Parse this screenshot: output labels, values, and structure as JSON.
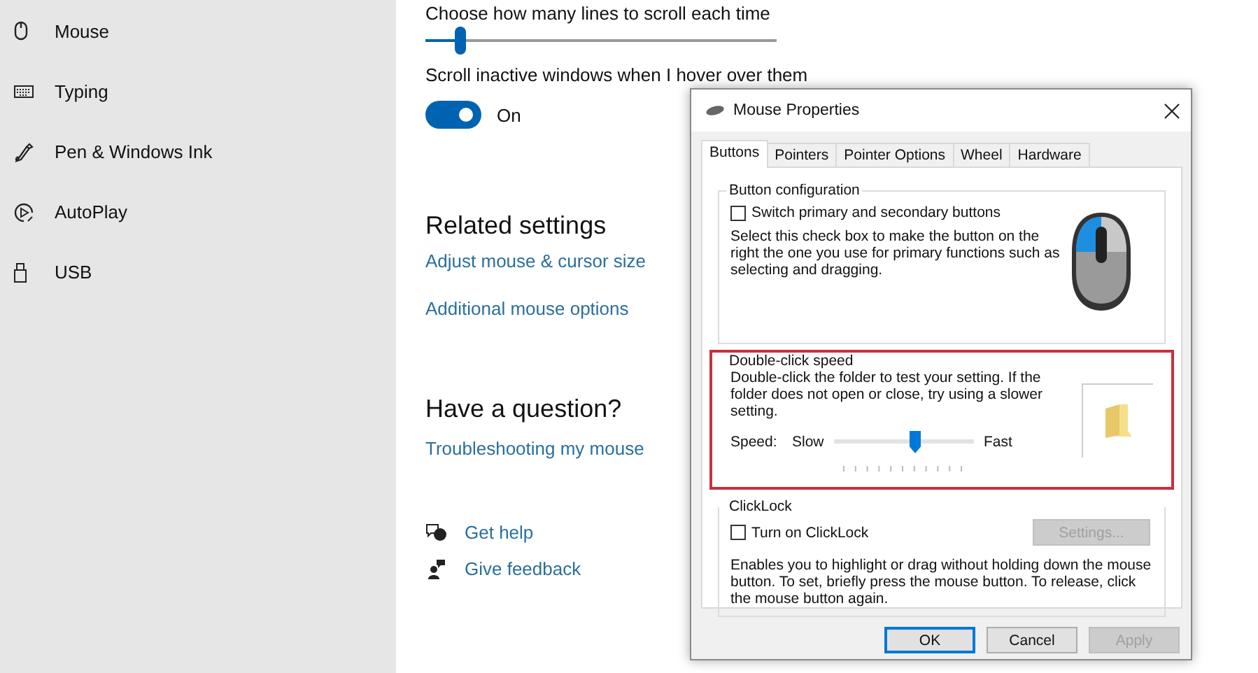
{
  "sidebar": {
    "items": [
      {
        "kind": "mouse",
        "label": "Mouse"
      },
      {
        "kind": "keyboard",
        "label": "Typing"
      },
      {
        "kind": "pen",
        "label": "Pen & Windows Ink"
      },
      {
        "kind": "autoplay",
        "label": "AutoPlay"
      },
      {
        "kind": "usb",
        "label": "USB"
      }
    ]
  },
  "main": {
    "wheel_lines": {
      "label": "Choose how many lines to scroll each time",
      "level": 0.1
    },
    "inactive_scroll": {
      "label": "Scroll inactive windows when I hover over them",
      "on": true,
      "state_text": "On"
    },
    "related": {
      "title": "Related settings",
      "links": [
        "Adjust mouse & cursor size",
        "Additional mouse options"
      ]
    },
    "question": {
      "title": "Have a question?",
      "links": [
        "Troubleshooting my mouse"
      ]
    },
    "help_links": [
      {
        "kind": "help",
        "label": "Get help"
      },
      {
        "kind": "feedback",
        "label": "Give feedback"
      }
    ]
  },
  "dialog": {
    "title": "Mouse Properties",
    "tabs": [
      {
        "label": "Buttons",
        "selected": true
      },
      {
        "label": "Pointers",
        "selected": false
      },
      {
        "label": "Pointer Options",
        "selected": false
      },
      {
        "label": "Wheel",
        "selected": false
      },
      {
        "label": "Hardware",
        "selected": false
      }
    ],
    "button_configuration": {
      "legend": "Button configuration",
      "checkbox": {
        "label": "Switch primary and secondary buttons",
        "checked": false
      },
      "description": "Select this check box to make the button on the right the one you use for primary functions such as selecting and dragging."
    },
    "double_click_speed": {
      "legend": "Double-click speed",
      "description": "Double-click the folder to test your setting. If the folder does not open or close, try using a slower setting.",
      "speed_label": "Speed:",
      "slow_label": "Slow",
      "fast_label": "Fast",
      "level": 0.58
    },
    "clicklock": {
      "legend": "ClickLock",
      "checkbox": {
        "label": "Turn on ClickLock",
        "checked": false
      },
      "settings_button": {
        "label": "Settings...",
        "disabled": true
      },
      "description": "Enables you to highlight or drag without holding down the mouse button. To set, briefly press the mouse button. To release, click the mouse button again."
    },
    "buttons": [
      {
        "label": "OK",
        "default": true,
        "disabled": false
      },
      {
        "label": "Cancel",
        "default": false,
        "disabled": false
      },
      {
        "label": "Apply",
        "default": false,
        "disabled": true
      }
    ]
  }
}
